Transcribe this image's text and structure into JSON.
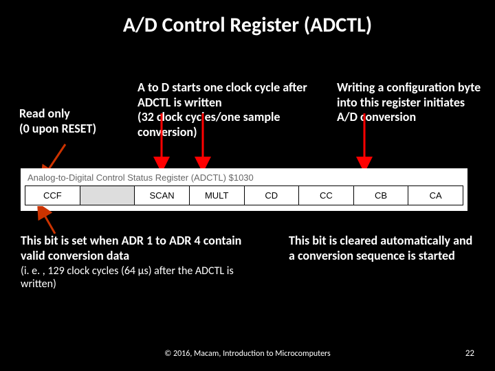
{
  "title": "A/D Control Register (ADCTL)",
  "notes": {
    "left": "Read only\n(0 upon RESET)",
    "mid": "A to D starts one clock cycle after ADCTL is written\n(32 clock cycles/one sample conversion)",
    "right": "Writing a configuration byte into this register initiates A/D conversion",
    "bl_bold": "This bit is set when ADR 1 to ADR 4 contain valid conversion data",
    "bl_sub": "(i. e. , 129 clock cycles (64 µs) after the ADCTL is written)",
    "br": "This bit is cleared automatically and a conversion sequence is started"
  },
  "register": {
    "caption": "Analog-to-Digital Control Status Register (ADCTL) $1030",
    "bits": [
      "CCF",
      "",
      "SCAN",
      "MULT",
      "CD",
      "CC",
      "CB",
      "CA"
    ]
  },
  "arrows": {
    "ccf_color": "#cc3300",
    "scan_color": "#ff0000",
    "mult_color": "#ff0000",
    "write_color": "#ff0000"
  },
  "footer": {
    "cite": "© 2016, Macam, Introduction to Microcomputers",
    "page": "22"
  }
}
